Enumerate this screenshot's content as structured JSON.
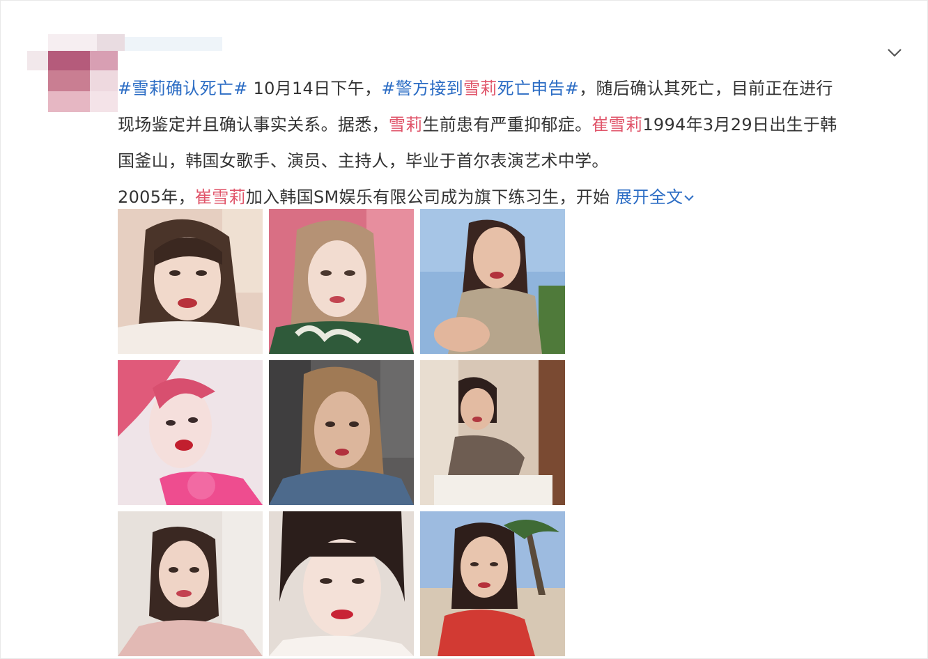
{
  "post": {
    "line1": {
      "tag1": "#雪莉确认死亡#",
      "text1": " 10月14日下午，",
      "tag2_a": "#警方接到",
      "tag2_name": "雪莉",
      "tag2_b": "死亡申告#",
      "text2": "，随后确认其死亡，目前正在进行"
    },
    "line2": {
      "text1": "现场鉴定并且确认事实关系。据悉，",
      "name1": "雪莉",
      "text2": "生前患有严重抑郁症。",
      "name2": "崔雪莉",
      "text3": "1994年3月29日出生于韩"
    },
    "line3": {
      "text1": "国釜山，韩国女歌手、演员、主持人，毕业于首尔表演艺术中学。"
    },
    "line4": {
      "text1": "2005年，",
      "name1": "崔雪莉",
      "text2": "加入韩国SM娱乐有限公司成为旗下练习生，开始 ",
      "expand": "展开全文"
    }
  },
  "icons": {
    "menu": "chevron-down-icon",
    "expand": "chevron-down-icon"
  },
  "colors": {
    "hashtag": "#2b6cc4",
    "name_highlight": "#e0556a",
    "text": "#333333"
  },
  "photos": [
    {
      "name": "photo-1"
    },
    {
      "name": "photo-2"
    },
    {
      "name": "photo-3"
    },
    {
      "name": "photo-4"
    },
    {
      "name": "photo-5"
    },
    {
      "name": "photo-6"
    },
    {
      "name": "photo-7"
    },
    {
      "name": "photo-8"
    },
    {
      "name": "photo-9"
    }
  ]
}
